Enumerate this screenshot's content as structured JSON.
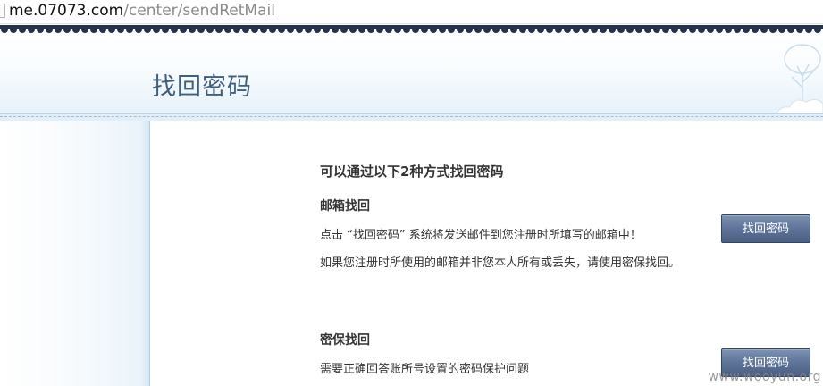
{
  "address_bar": {
    "url_host": "me.07073.com",
    "url_path": "/center/sendRetMail"
  },
  "header": {
    "title": "找回密码"
  },
  "content": {
    "intro": "可以通过以下2种方式找回密码",
    "email_section": {
      "title": "邮箱找回",
      "line1": "点击 “找回密码” 系统将发送邮件到您注册时所填写的邮箱中！",
      "line2": "如果您注册时所使用的邮箱并非您本人所有或丢失，请使用密保找回。",
      "button_label": "找回密码"
    },
    "security_section": {
      "title": "密保找回",
      "line1": "需要正确回答账所号设置的密码保护问题",
      "button_label": "找回密码"
    }
  },
  "watermark": "www.wooyun.org",
  "colors": {
    "title": "#3f5f7f",
    "scallop": "#24324a",
    "header_gradient_end": "#e6f1f9",
    "button": "#5a7094"
  },
  "icons": {
    "address_page_icon": "page-icon",
    "header_decoration": "tree-icon"
  }
}
